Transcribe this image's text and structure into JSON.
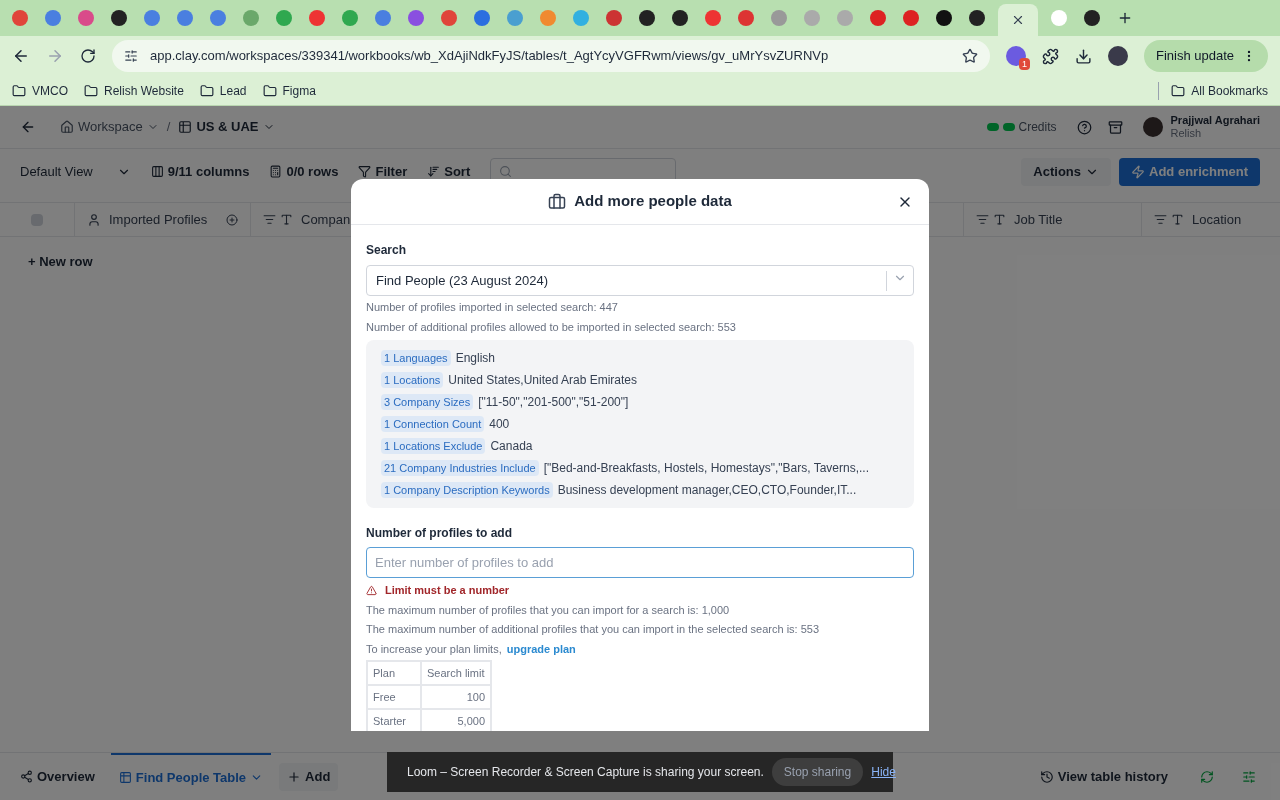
{
  "browser": {
    "tabs": [
      {
        "selected": false
      },
      {
        "selected": false
      },
      {
        "selected": false
      },
      {
        "selected": false
      },
      {
        "selected": false
      },
      {
        "selected": false
      },
      {
        "selected": false
      },
      {
        "selected": false
      },
      {
        "selected": false
      },
      {
        "selected": false
      },
      {
        "selected": false
      },
      {
        "selected": false
      },
      {
        "selected": false
      },
      {
        "selected": false
      },
      {
        "selected": false
      },
      {
        "selected": false
      },
      {
        "selected": false
      },
      {
        "selected": false
      },
      {
        "selected": false
      },
      {
        "selected": false
      },
      {
        "selected": false
      },
      {
        "selected": false
      },
      {
        "selected": false
      },
      {
        "selected": false
      },
      {
        "selected": false
      },
      {
        "selected": false
      },
      {
        "selected": false
      },
      {
        "selected": false
      },
      {
        "selected": false
      },
      {
        "selected": false
      },
      {
        "selected": true
      },
      {
        "selected": false
      },
      {
        "selected": false
      }
    ],
    "url": "app.clay.com/workspaces/339341/workbooks/wb_XdAjiNdkFyJS/tables/t_AgtYcyVGFRwm/views/gv_uMrYsvZURNVp",
    "extension_badge": "1",
    "update_button": "Finish update",
    "bookmarks": [
      "VMCO",
      "Relish Website",
      "Lead",
      "Figma"
    ],
    "all_bookmarks": "All Bookmarks"
  },
  "header": {
    "breadcrumbs": [
      "Workspace",
      "US & UAE"
    ],
    "separator": "/",
    "credits": "Credits",
    "user": {
      "name": "Prajjwal Agrahari",
      "org": "Relish"
    }
  },
  "toolbar": {
    "view": "Default View",
    "columns": "9/11 columns",
    "rows": "0/0 rows",
    "filter": "Filter",
    "sort": "Sort",
    "actions": "Actions",
    "add_enrichment": "Add enrichment"
  },
  "table": {
    "select_all": {
      "checked": false
    },
    "columns": [
      {
        "kind": "person",
        "label": "Imported Profiles"
      },
      {
        "kind": "text",
        "label": "Compan"
      },
      {
        "kind": "text",
        "label": "Job Title"
      },
      {
        "kind": "text",
        "label": "Location"
      }
    ],
    "new_row": "+ New row"
  },
  "modal": {
    "title": "Add more people data",
    "search_label": "Search",
    "search_value": "Find People (23 August 2024)",
    "info": [
      "Number of profiles imported in selected search: 447",
      "Number of additional profiles allowed to be imported in selected search: 553"
    ],
    "filters": [
      {
        "tag": "1 Languages",
        "value": "English"
      },
      {
        "tag": "1 Locations",
        "value": "United States,United Arab Emirates"
      },
      {
        "tag": "3 Company Sizes",
        "value": "[\"11-50\",\"201-500\",\"51-200\"]"
      },
      {
        "tag": "1 Connection Count",
        "value": "400"
      },
      {
        "tag": "1 Locations Exclude",
        "value": "Canada"
      },
      {
        "tag": "21 Company Industries Include",
        "value": "[\"Bed-and-Breakfasts, Hostels, Homestays\",\"Bars, Taverns,..."
      },
      {
        "tag": "1 Company Description Keywords",
        "value": "Business development manager,CEO,CTO,Founder,IT..."
      }
    ],
    "count_label": "Number of profiles to add",
    "count_placeholder": "Enter number of profiles to add",
    "error": "Limit must be a number",
    "limits": [
      "The maximum number of profiles that you can import for a search is: 1,000",
      "The maximum number of additional profiles that you can import in the selected search is: 553"
    ],
    "upgrade_text": "To increase your plan limits,",
    "upgrade_link": "upgrade plan",
    "plan_table": {
      "columns": [
        "Plan",
        "Search limit"
      ],
      "rows": [
        [
          "Free",
          "100"
        ],
        [
          "Starter",
          "5,000"
        ]
      ]
    }
  },
  "bottom_bar": {
    "tabs": [
      {
        "label": "Overview",
        "selected": false
      },
      {
        "label": "Find People Table",
        "selected": true
      }
    ],
    "add": "Add",
    "history": "View table history"
  },
  "loom": {
    "message": "Loom – Screen Recorder & Screen Capture is sharing your screen.",
    "stop": "Stop sharing",
    "hide": "Hide"
  }
}
